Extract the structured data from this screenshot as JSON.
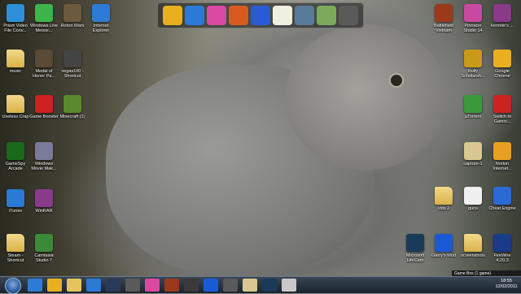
{
  "desktop_icons_left": [
    {
      "id": "prism",
      "label": "Prism Video File Conv...",
      "icon": "prism-icon",
      "color": "#2d8fd9"
    },
    {
      "id": "wlm",
      "label": "Windows Live Messe...",
      "icon": "messenger-icon",
      "color": "#3bb54a"
    },
    {
      "id": "robotwars",
      "label": "Robot Wars",
      "icon": "robot-icon",
      "color": "#6b5a3e"
    },
    {
      "id": "ie",
      "label": "Internet Explorer",
      "icon": "ie-icon",
      "color": "#2e7bd6"
    },
    {
      "id": "music",
      "label": "music",
      "icon": "folder-icon",
      "color": "#e6c45a"
    },
    {
      "id": "moh",
      "label": "Medal of Honor Pa...",
      "icon": "soldier-icon",
      "color": "#5a4a36"
    },
    {
      "id": "vegas",
      "label": "vegas100 - Shortcut",
      "icon": "video-icon",
      "color": "#444"
    },
    {
      "id": "uselesscrap",
      "label": "Useless Crap",
      "icon": "folder-icon",
      "color": "#e6c45a"
    },
    {
      "id": "gamebooster",
      "label": "Game Booster",
      "icon": "booster-icon",
      "color": "#c22"
    },
    {
      "id": "minecraft",
      "label": "Minecraft (1)",
      "icon": "minecraft-icon",
      "color": "#5a8a2e"
    },
    {
      "id": "gamespy",
      "label": "GameSpy Arcade",
      "icon": "gamespy-icon",
      "color": "#1a6a1a"
    },
    {
      "id": "wmm",
      "label": "Windows Movie Mak...",
      "icon": "film-icon",
      "color": "#7a7a9a"
    },
    {
      "id": "itunes",
      "label": "iTunes",
      "icon": "itunes-icon",
      "color": "#2a7ad6"
    },
    {
      "id": "winrar",
      "label": "WinRAR",
      "icon": "winrar-icon",
      "color": "#8a3a8a"
    },
    {
      "id": "steam",
      "label": "Steam - Shortcut",
      "icon": "folder-icon",
      "color": "#e6c45a"
    },
    {
      "id": "camtasia",
      "label": "Camtasia Studio 7",
      "icon": "camtasia-icon",
      "color": "#3a8a3a"
    }
  ],
  "desktop_icons_right": [
    {
      "id": "bfv",
      "label": "Battlefield Vietnam",
      "icon": "battlefield-icon",
      "color": "#9a3a1a"
    },
    {
      "id": "pinnacle",
      "label": "Pinnacle Studio 14",
      "icon": "pinnacle-icon",
      "color": "#c84aa0"
    },
    {
      "id": "kermit",
      "label": "kermite's ...",
      "icon": "winrar-icon",
      "color": "#8a3a8a"
    },
    {
      "id": "bully",
      "label": "Bully Scholarsh...",
      "icon": "bully-icon",
      "color": "#c89a1a"
    },
    {
      "id": "chrome",
      "label": "Google Chrome",
      "icon": "chrome-icon",
      "color": "#e8b020"
    },
    {
      "id": "utorrent",
      "label": "µTorrent",
      "icon": "utorrent-icon",
      "color": "#3a9a3a"
    },
    {
      "id": "switch",
      "label": "Switch to Gamin...",
      "icon": "power-icon",
      "color": "#c22"
    },
    {
      "id": "capture",
      "label": "capture-1",
      "icon": "capture-icon",
      "color": "#d8c890"
    },
    {
      "id": "norton",
      "label": "Norton Internet...",
      "icon": "norton-icon",
      "color": "#e8a020"
    },
    {
      "id": "vids",
      "label": "vids 2",
      "icon": "folder-icon",
      "color": "#e6c45a"
    },
    {
      "id": "guns",
      "label": "guns",
      "icon": "document-icon",
      "color": "#f0f0f0"
    },
    {
      "id": "cheat",
      "label": "Cheat Engine",
      "icon": "cheat-icon",
      "color": "#2a6ad6"
    },
    {
      "id": "lifecam",
      "label": "Microsoft LifeCam",
      "icon": "webcam-icon",
      "color": "#1a3a5a"
    },
    {
      "id": "garrys",
      "label": "Garry's Mod",
      "icon": "gmod-icon",
      "color": "#1a5ad6"
    },
    {
      "id": "screenshots",
      "label": "screenshots",
      "icon": "folder-icon",
      "color": "#e6c45a"
    },
    {
      "id": "fraps",
      "label": "FireWire 4.20.3",
      "icon": "firewire-icon",
      "color": "#1a3a8a"
    }
  ],
  "dock_items": [
    {
      "name": "chrome",
      "icon": "chrome-icon",
      "color": "#e8b020"
    },
    {
      "name": "itunes",
      "icon": "itunes-icon",
      "color": "#2a7ad6"
    },
    {
      "name": "picasa",
      "icon": "picasa-icon",
      "color": "#d84aa0"
    },
    {
      "name": "powerpoint",
      "icon": "powerpoint-icon",
      "color": "#d85a20"
    },
    {
      "name": "word",
      "icon": "word-icon",
      "color": "#2a5ad6"
    },
    {
      "name": "notepad",
      "icon": "notepad-icon",
      "color": "#f0f0e0"
    },
    {
      "name": "computer",
      "icon": "computer-icon",
      "color": "#5a7a9a"
    },
    {
      "name": "stacks",
      "icon": "stacks-icon",
      "color": "#7aaa5a"
    },
    {
      "name": "clipboard",
      "icon": "clipboard-icon",
      "color": "#5a5a5a"
    }
  ],
  "taskbar": {
    "items": [
      {
        "name": "ie",
        "icon": "ie-icon",
        "color": "#2e7bd6"
      },
      {
        "name": "chrome",
        "icon": "chrome-icon",
        "color": "#e8b020"
      },
      {
        "name": "explorer",
        "icon": "folder-icon",
        "color": "#e6c45a"
      },
      {
        "name": "itunes",
        "icon": "itunes-icon",
        "color": "#2a7ad6"
      },
      {
        "name": "steam",
        "icon": "steam-icon",
        "color": "#2a3a5a"
      },
      {
        "name": "media",
        "icon": "media-icon",
        "color": "#5a5a5a"
      },
      {
        "name": "picasa",
        "icon": "picasa-icon",
        "color": "#d84aa0"
      },
      {
        "name": "bfv",
        "icon": "battlefield-icon",
        "color": "#9a3a1a"
      },
      {
        "name": "game",
        "icon": "game-icon",
        "color": "#3a3a3a"
      },
      {
        "name": "gmod",
        "icon": "gmod-icon",
        "color": "#1a5ad6"
      },
      {
        "name": "tool",
        "icon": "tool-icon",
        "color": "#5a5a5a"
      },
      {
        "name": "notes",
        "icon": "notes-icon",
        "color": "#d8c890"
      },
      {
        "name": "lifecam",
        "icon": "webcam-icon",
        "color": "#1a3a5a"
      },
      {
        "name": "chart",
        "icon": "chart-icon",
        "color": "#c8c8c8"
      }
    ],
    "gamebox_label": "Game Box",
    "gamebox_count": "(1 game)",
    "clock_time": "18:55",
    "clock_date": "12/02/2011"
  }
}
